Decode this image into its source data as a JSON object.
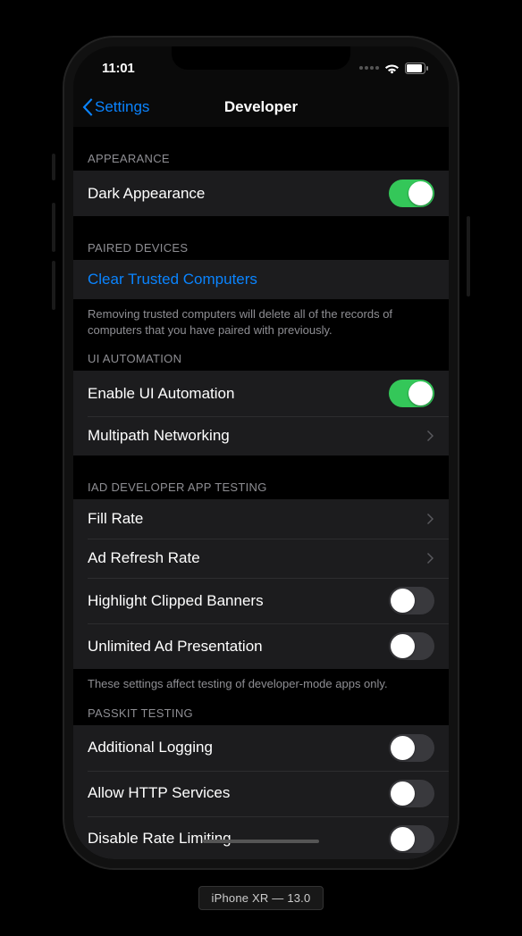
{
  "status": {
    "time": "11:01"
  },
  "nav": {
    "back_label": "Settings",
    "title": "Developer"
  },
  "sections": {
    "appearance": {
      "header": "APPEARANCE",
      "dark_label": "Dark Appearance",
      "dark_on": true
    },
    "paired": {
      "header": "PAIRED DEVICES",
      "clear_label": "Clear Trusted Computers",
      "footer": "Removing trusted computers will delete all of the records of computers that you have paired with previously."
    },
    "ui_automation": {
      "header": "UI AUTOMATION",
      "enable_label": "Enable UI Automation",
      "enable_on": true,
      "multipath_label": "Multipath Networking"
    },
    "iad": {
      "header": "IAD DEVELOPER APP TESTING",
      "fill_rate_label": "Fill Rate",
      "ad_refresh_label": "Ad Refresh Rate",
      "highlight_label": "Highlight Clipped Banners",
      "highlight_on": false,
      "unlimited_label": "Unlimited Ad Presentation",
      "unlimited_on": false,
      "footer": "These settings affect testing of developer-mode apps only."
    },
    "passkit": {
      "header": "PASSKIT TESTING",
      "logging_label": "Additional Logging",
      "logging_on": false,
      "http_label": "Allow HTTP Services",
      "http_on": false,
      "rate_label": "Disable Rate Limiting",
      "rate_on": false
    }
  },
  "device_caption": "iPhone XR — 13.0"
}
